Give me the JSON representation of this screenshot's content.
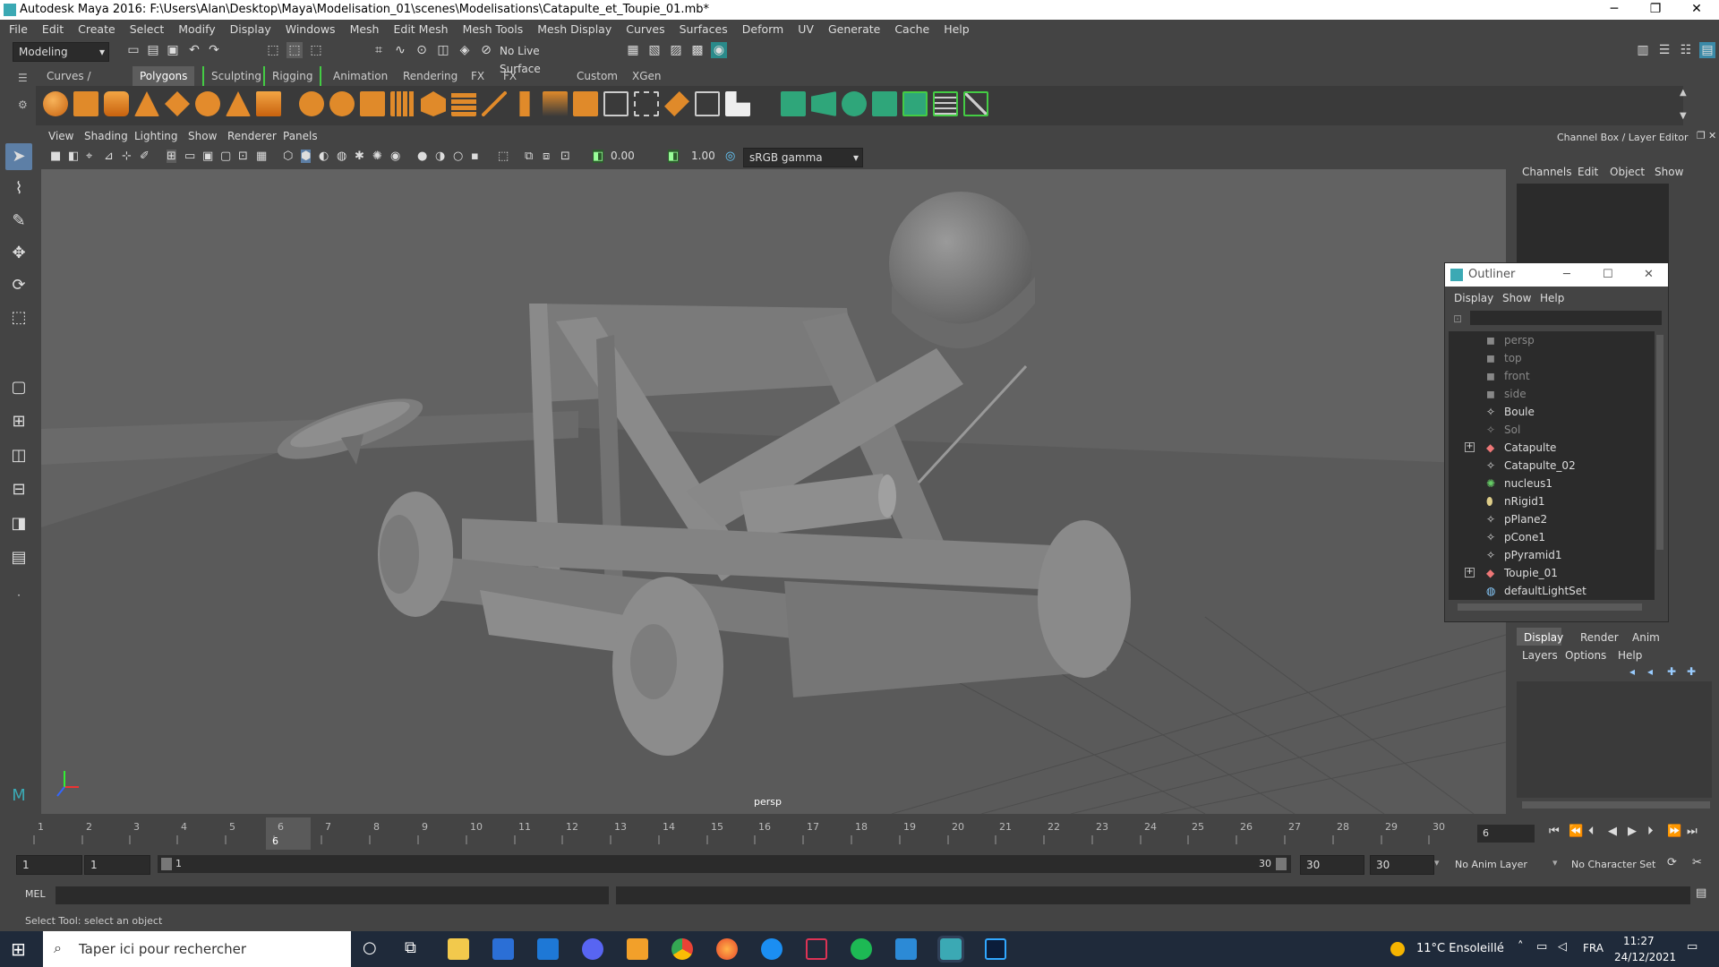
{
  "window": {
    "title": "Autodesk Maya 2016: F:\\Users\\Alan\\Desktop\\Maya\\Modelisation_01\\scenes\\Modelisations\\Catapulte_et_Toupie_01.mb*"
  },
  "menubar": [
    "File",
    "Edit",
    "Create",
    "Select",
    "Modify",
    "Display",
    "Windows",
    "Mesh",
    "Edit Mesh",
    "Mesh Tools",
    "Mesh Display",
    "Curves",
    "Surfaces",
    "Deform",
    "UV",
    "Generate",
    "Cache",
    "Help"
  ],
  "statusline": {
    "menuset": "Modeling",
    "live_surface": "No Live Surface"
  },
  "shelf": {
    "tabs": [
      "Curves / Surfaces",
      "Polygons",
      "Sculpting",
      "Rigging",
      "Animation",
      "Rendering",
      "FX",
      "FX Caching",
      "Custom",
      "XGen"
    ],
    "active_tab": "Polygons"
  },
  "viewport": {
    "menus": [
      "View",
      "Shading",
      "Lighting",
      "Show",
      "Renderer",
      "Panels"
    ],
    "exposure": "0.00",
    "gamma": "1.00",
    "colorspace": "sRGB gamma",
    "camera_label": "persp"
  },
  "channelbox": {
    "title": "Channel Box / Layer Editor",
    "menus": [
      "Channels",
      "Edit",
      "Object",
      "Show"
    ],
    "layer_tabs": [
      "Display",
      "Render",
      "Anim"
    ],
    "layer_menus": [
      "Layers",
      "Options",
      "Help"
    ]
  },
  "outliner": {
    "title": "Outliner",
    "menus": [
      "Display",
      "Show",
      "Help"
    ],
    "items": [
      {
        "label": "persp",
        "type": "camera",
        "dim": true
      },
      {
        "label": "top",
        "type": "camera",
        "dim": true
      },
      {
        "label": "front",
        "type": "camera",
        "dim": true
      },
      {
        "label": "side",
        "type": "camera",
        "dim": true
      },
      {
        "label": "Boule",
        "type": "mesh",
        "dim": false
      },
      {
        "label": "Sol",
        "type": "mesh",
        "dim": true
      },
      {
        "label": "Catapulte",
        "type": "group",
        "dim": false,
        "expandable": true
      },
      {
        "label": "Catapulte_02",
        "type": "mesh",
        "dim": false
      },
      {
        "label": "nucleus1",
        "type": "nucleus",
        "dim": false
      },
      {
        "label": "nRigid1",
        "type": "nrigid",
        "dim": false
      },
      {
        "label": "pPlane2",
        "type": "mesh",
        "dim": false
      },
      {
        "label": "pCone1",
        "type": "mesh",
        "dim": false
      },
      {
        "label": "pPyramid1",
        "type": "mesh",
        "dim": false
      },
      {
        "label": "Toupie_01",
        "type": "group",
        "dim": false,
        "expandable": true
      },
      {
        "label": "defaultLightSet",
        "type": "set",
        "dim": false
      }
    ]
  },
  "timeline": {
    "ticks": [
      "1",
      "2",
      "3",
      "4",
      "5",
      "6",
      "7",
      "8",
      "9",
      "10",
      "11",
      "12",
      "13",
      "14",
      "15",
      "16",
      "17",
      "18",
      "19",
      "20",
      "21",
      "22",
      "23",
      "24",
      "25",
      "26",
      "27",
      "28",
      "29",
      "30"
    ],
    "current_frame_marker": "6",
    "current_frame": "6"
  },
  "range": {
    "start": "1",
    "playback_start": "1",
    "slider_start": "1",
    "slider_end": "30",
    "playback_end": "30",
    "end": "30",
    "anim_layer": "No Anim Layer",
    "character_set": "No Character Set"
  },
  "cmdline": {
    "label": "MEL"
  },
  "helpline": {
    "text": "Select Tool: select an object"
  },
  "taskbar": {
    "search_placeholder": "Taper ici pour rechercher",
    "weather": "11°C  Ensoleillé",
    "language": "FRA",
    "time": "11:27",
    "date": "24/12/2021"
  }
}
